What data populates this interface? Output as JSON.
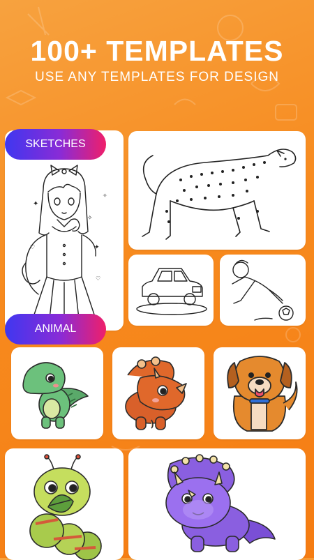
{
  "header": {
    "title": "100+ TEMPLATES",
    "subtitle": "USE ANY TEMPLATES FOR DESIGN"
  },
  "categories": {
    "sketches_label": "SKETCHES",
    "animal_label": "ANIMAL"
  },
  "colors": {
    "background": "#f78a1e",
    "pill_start": "#3f37f0",
    "pill_end": "#ef1f6a",
    "card": "#ffffff"
  },
  "templates": [
    {
      "name": "girl-sketch",
      "category": "SKETCHES"
    },
    {
      "name": "leopard-sketch",
      "category": "SKETCHES"
    },
    {
      "name": "car-sketch",
      "category": "SKETCHES"
    },
    {
      "name": "soccer-boy-sketch",
      "category": "SKETCHES"
    },
    {
      "name": "green-dinosaur",
      "category": "ANIMAL"
    },
    {
      "name": "orange-triceratops",
      "category": "ANIMAL"
    },
    {
      "name": "brown-dog",
      "category": "ANIMAL"
    },
    {
      "name": "caterpillar",
      "category": "ANIMAL"
    },
    {
      "name": "purple-triceratops",
      "category": "ANIMAL"
    }
  ]
}
